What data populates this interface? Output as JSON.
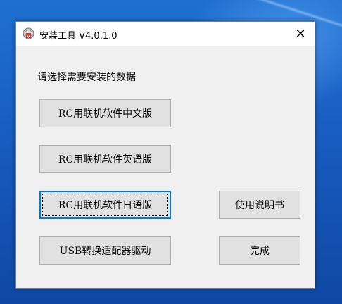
{
  "window": {
    "title": "安装工具 V4.0.1.0",
    "app_icon": "installer-app-icon",
    "close_glyph": "✕"
  },
  "content": {
    "instruction": "请选择需要安装的数据"
  },
  "buttons": {
    "chinese": "RC用联机软件中文版",
    "english": "RC用联机软件英语版",
    "japanese": "RC用联机软件日语版",
    "usb_driver": "USB转换适配器驱动",
    "manual": "使用说明书",
    "finish": "完成"
  },
  "colors": {
    "desktop": "#1a63c6",
    "window_bg": "#f0f0f0",
    "button_bg": "#e1e1e1",
    "focus_border": "#0078d7"
  }
}
